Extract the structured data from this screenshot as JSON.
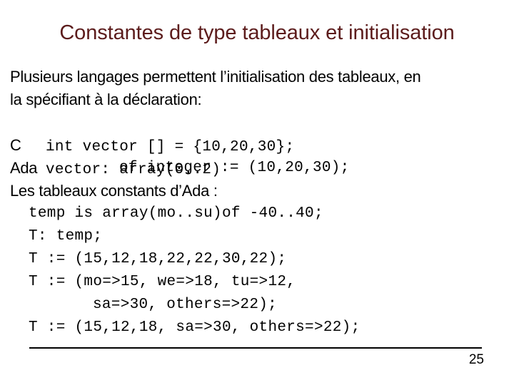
{
  "slide": {
    "title": "Constantes de type tableaux et initialisation",
    "title_color": "#5c1c1c",
    "background_color": "#ffffff",
    "text_color": "#000000",
    "page_number": "25"
  },
  "body": {
    "intro_line_1": "Plusieurs langages permettent l’initialisation des tableaux, en",
    "intro_line_2": "la spécifiant à la déclaration:",
    "c_label": "C",
    "c_code": "int vector [] = {10,20,30};",
    "ada_label": "Ada",
    "ada_code": "vector: array(0..2)",
    "ada_code_cont": "of integer := (10,20,30);",
    "ada_const_heading": "Les tableaux constants d’Ada :",
    "code_lines": [
      "temp is array(mo..su)of -40..40;",
      "T: temp;",
      "T := (15,12,18,22,22,30,22);",
      "T := (mo=>15, we=>18, tu=>12,",
      "sa=>30, others=>22);",
      "T := (15,12,18, sa=>30, others=>22);"
    ]
  }
}
